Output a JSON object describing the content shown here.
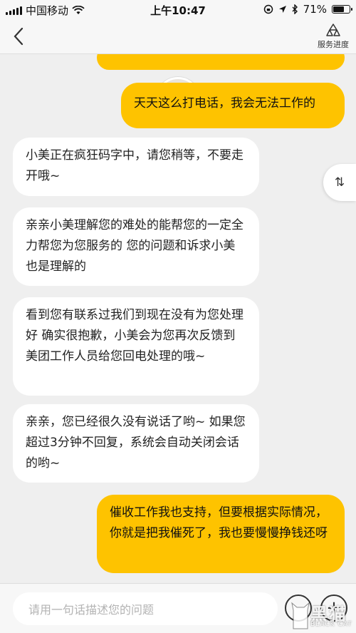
{
  "status": {
    "carrier": "中国移动",
    "time": "上午10:47",
    "battery": "71%",
    "battery_level": 0.71
  },
  "nav": {
    "progress_label": "服务进度"
  },
  "side_tab": {
    "label": "⇅"
  },
  "messages": [
    {
      "from": "me",
      "text": "天天这么打电话，我会无法工作的"
    },
    {
      "from": "bot",
      "text": "小美正在疯狂码字中，请您稍等，不要走开哦~"
    },
    {
      "from": "bot",
      "text": "亲亲小美理解您的难处的能帮您的一定全力帮您为您服务的 您的问题和诉求小美也是理解的"
    },
    {
      "from": "bot",
      "text": "看到您有联系过我们到现在没有为您处理好 确实很抱歉，小美会为您再次反馈到美团工作人员给您回电处理的哦~"
    },
    {
      "from": "bot",
      "text": "亲亲，您已经很久没有说话了哟~ 如果您超过3分钟不回复，系统会自动关闭会话的哟~"
    },
    {
      "from": "me",
      "text": "催收工作我也支持，但要根据实际情况，你就是把我催死了，我也要慢慢挣钱还呀"
    }
  ],
  "input": {
    "placeholder": "请用一句话描述您的问题"
  },
  "watermark": {
    "cn": "黑猫",
    "en": "BLACK CAT"
  },
  "colors": {
    "user_bubble": "#fec300",
    "bot_bubble": "#ffffff",
    "background": "#efefef"
  }
}
